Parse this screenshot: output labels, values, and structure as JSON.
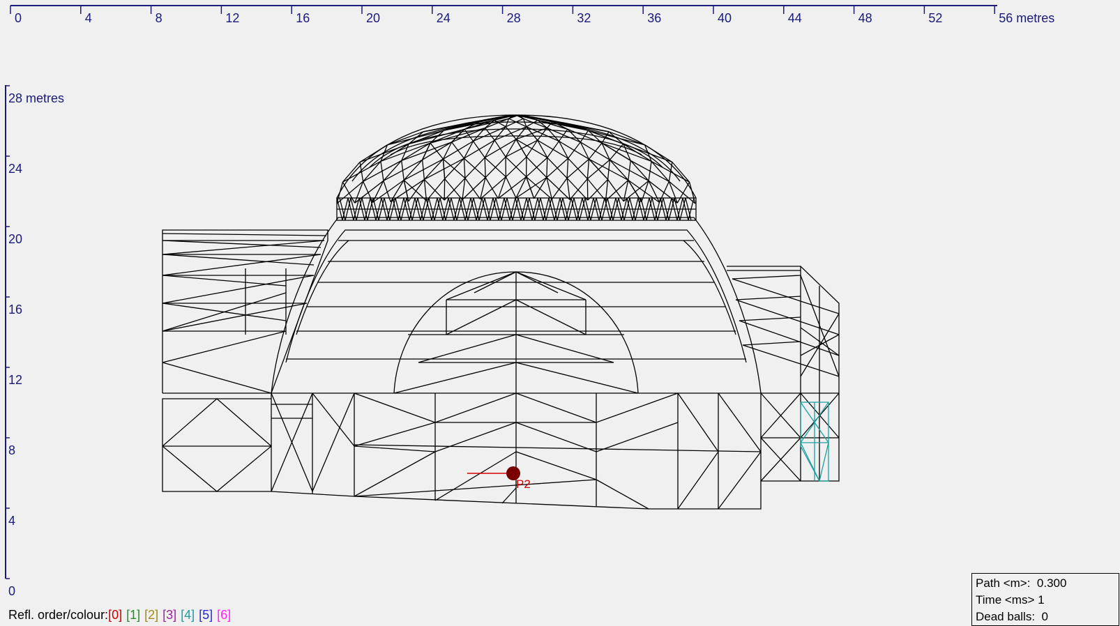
{
  "top_ruler": {
    "ticks": [
      "0",
      "4",
      "8",
      "12",
      "16",
      "20",
      "24",
      "28",
      "32",
      "36",
      "40",
      "44",
      "48",
      "52",
      "56 metres"
    ]
  },
  "left_ruler": {
    "ticks": [
      "0",
      "4",
      "8",
      "12",
      "16",
      "20",
      "24",
      "28 metres"
    ]
  },
  "source": {
    "label": "P2",
    "color": "#d40000",
    "marker_color": "#7a0000"
  },
  "colors": {
    "ruler": "#1a1a7a",
    "wireframe": "#000000",
    "highlight": "#1aa0a0"
  },
  "info": {
    "path_label": "Path <m>:",
    "path_value": "0.300",
    "time_label": "Time <ms>",
    "time_value": "1",
    "dead_label": "Dead balls:",
    "dead_value": "0"
  },
  "legend": {
    "label": "Refl. order/colour:",
    "items": [
      {
        "text": "[0]",
        "color": "#cc0000"
      },
      {
        "text": "[1]",
        "color": "#2a8a2a"
      },
      {
        "text": "[2]",
        "color": "#a08a1a"
      },
      {
        "text": "[3]",
        "color": "#a020a0"
      },
      {
        "text": "[4]",
        "color": "#1aa0a0"
      },
      {
        "text": "[5]",
        "color": "#2a2ad0"
      },
      {
        "text": "[6]",
        "color": "#ff20ff"
      }
    ]
  }
}
